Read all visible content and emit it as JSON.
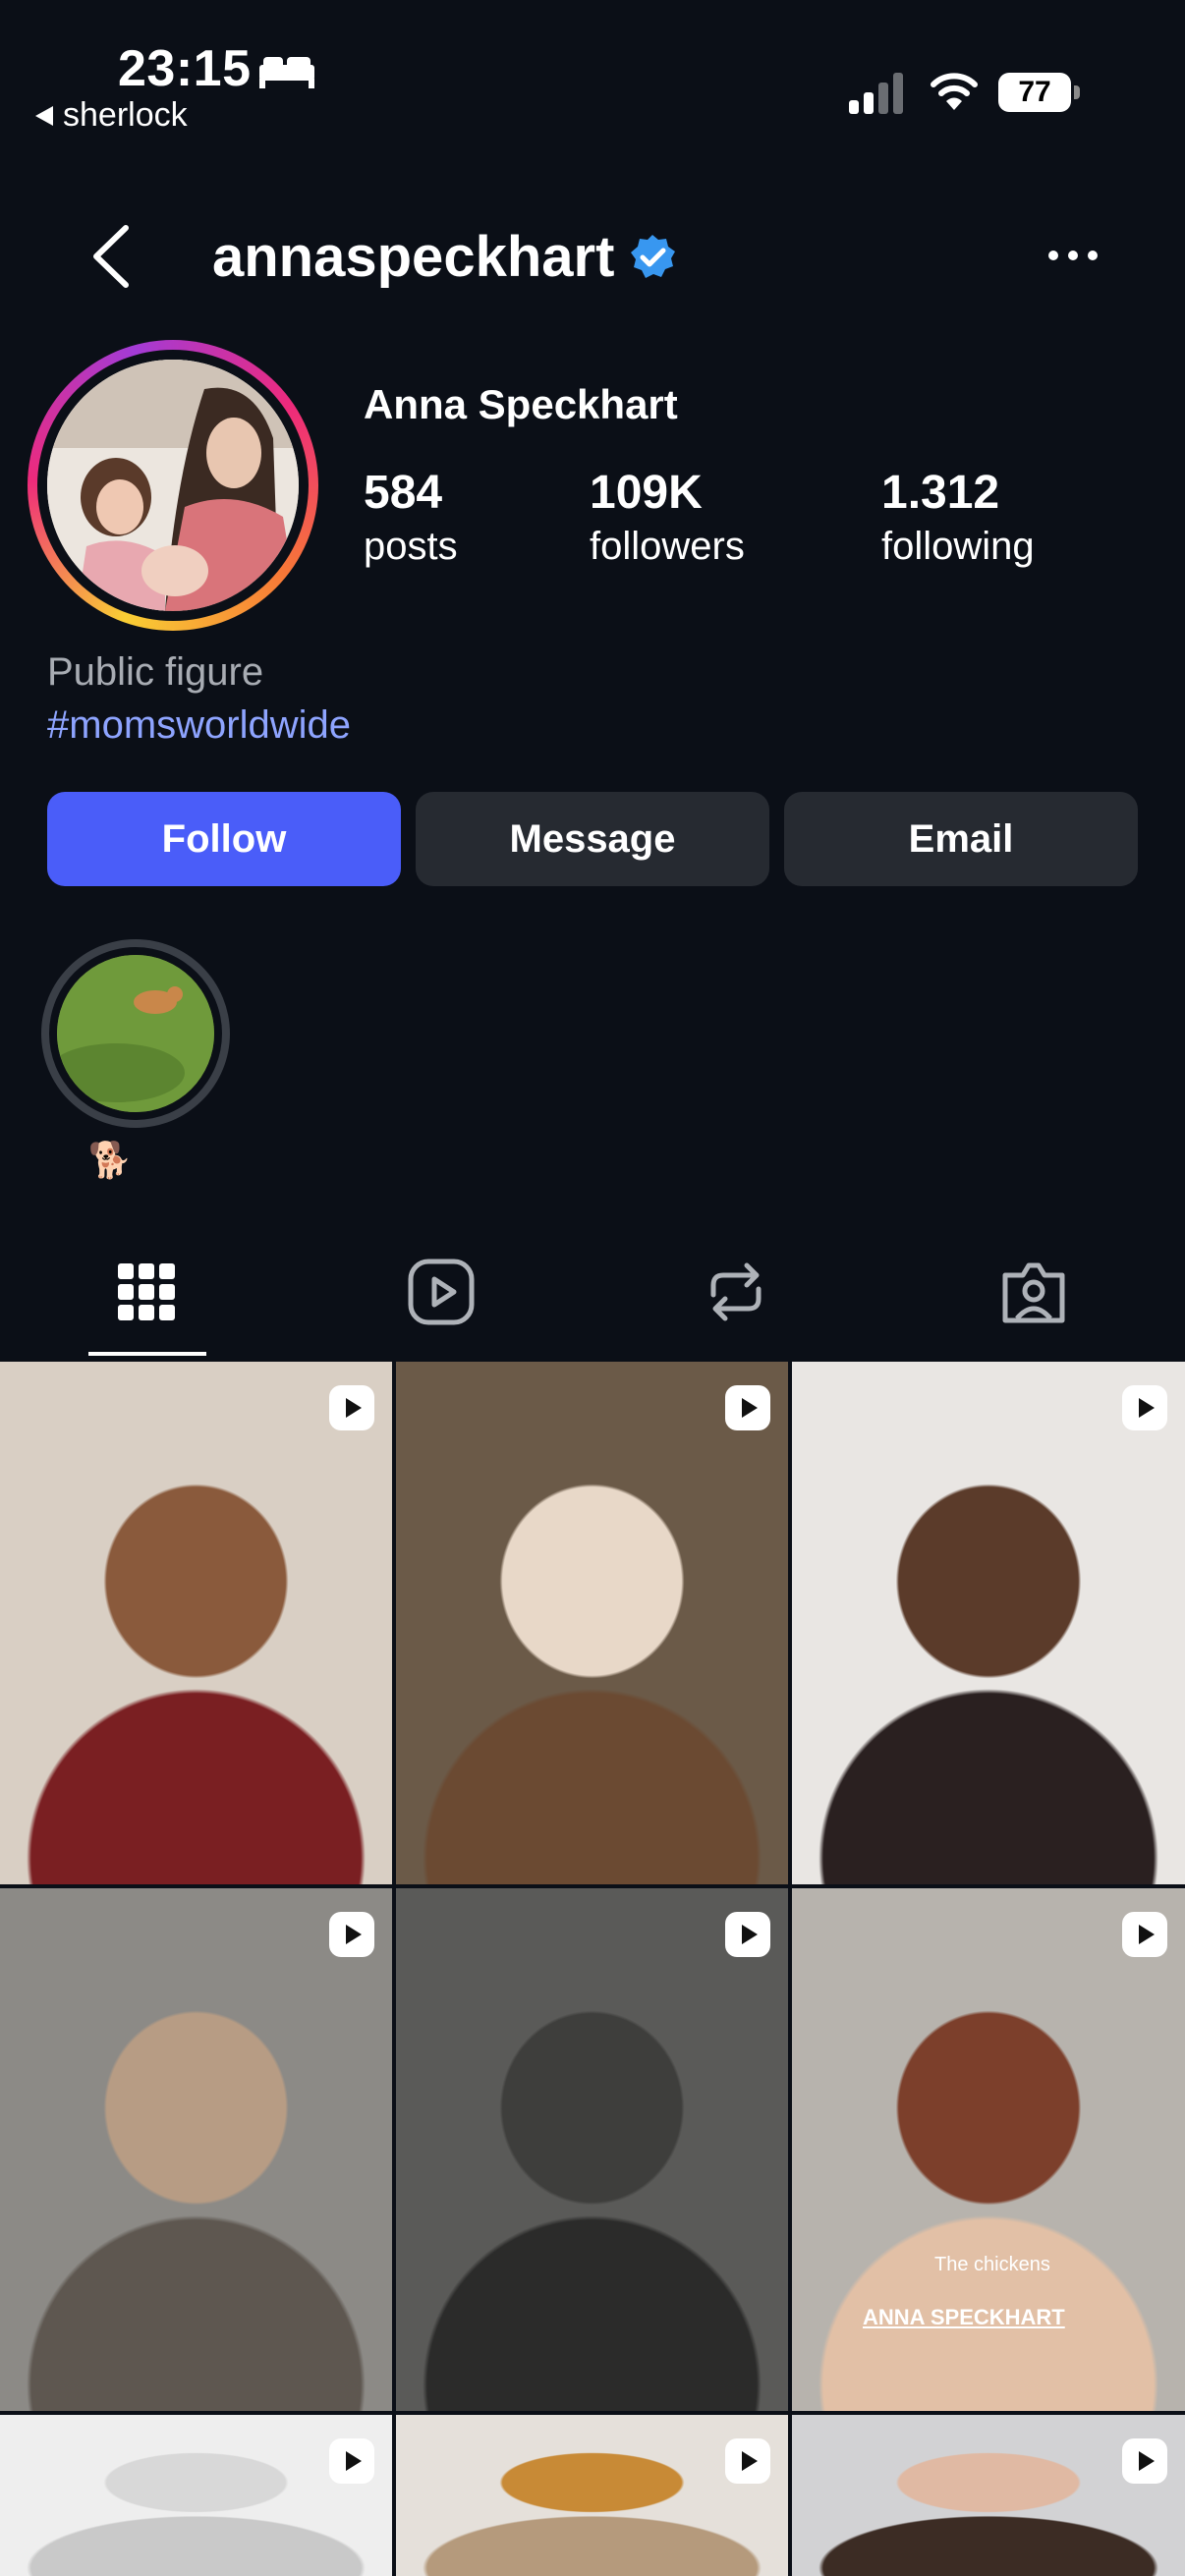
{
  "status_bar": {
    "time": "23:15",
    "back_app": "sherlock",
    "battery": "77"
  },
  "header": {
    "username": "annaspeckhart"
  },
  "profile": {
    "full_name": "Anna Speckhart",
    "stats": [
      {
        "value": "584",
        "label": "posts"
      },
      {
        "value": "109K",
        "label": "followers"
      },
      {
        "value": "1.312",
        "label": "following"
      }
    ],
    "category": "Public figure",
    "hashtag": "#momsworldwide"
  },
  "actions": {
    "follow": "Follow",
    "message": "Message",
    "email": "Email"
  },
  "highlights": [
    {
      "label": "🐕"
    }
  ],
  "tabs": [
    "posts-grid",
    "reels",
    "reposts",
    "tagged"
  ],
  "grid": {
    "tiles": [
      {
        "colors": [
          "#d9cfc4",
          "#8a5a3c",
          "#7a1f22"
        ]
      },
      {
        "colors": [
          "#6b5a48",
          "#e8d8c8",
          "#6b4a32"
        ]
      },
      {
        "colors": [
          "#e9e6e3",
          "#5b3b2a",
          "#2a2020"
        ]
      },
      {
        "colors": [
          "#8c8a86",
          "#b79c84",
          "#5e5750"
        ]
      },
      {
        "colors": [
          "#5a5a58",
          "#3e3e3c",
          "#2b2b2a"
        ]
      },
      {
        "colors": [
          "#b7b3ad",
          "#7c3f2b",
          "#e2c0a6"
        ]
      },
      {
        "colors": [
          "#eeeeee",
          "#d8d8d8",
          "#c9c9c9"
        ]
      },
      {
        "colors": [
          "#e5e0da",
          "#c88a36",
          "#b59a7c"
        ]
      },
      {
        "colors": [
          "#d2d2d4",
          "#e0b9a3",
          "#3c2c24"
        ]
      }
    ],
    "caption_text": "The chickens",
    "caption_credit": "ANNA SPECKHART"
  }
}
